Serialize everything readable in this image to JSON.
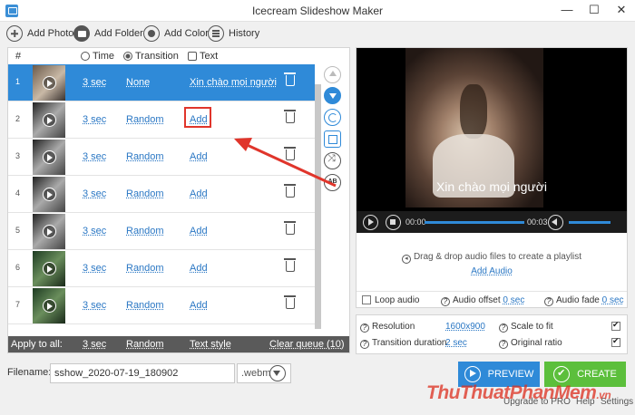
{
  "window": {
    "title": "Icecream Slideshow Maker",
    "minimize": "—",
    "maximize": "☐",
    "close": "✕"
  },
  "toolbar": {
    "add_photo": "Add Photo",
    "add_folder": "Add Folder",
    "add_color": "Add Color",
    "history": "History"
  },
  "columns": {
    "num": "#",
    "time": "Time",
    "transition": "Transition",
    "text": "Text"
  },
  "slides": [
    {
      "num": "1",
      "time": "3 sec",
      "transition": "None",
      "text": "Xin chào mọi người",
      "selected": true
    },
    {
      "num": "2",
      "time": "3 sec",
      "transition": "Random",
      "text": "Add"
    },
    {
      "num": "3",
      "time": "3 sec",
      "transition": "Random",
      "text": "Add"
    },
    {
      "num": "4",
      "time": "3 sec",
      "transition": "Random",
      "text": "Add"
    },
    {
      "num": "5",
      "time": "3 sec",
      "transition": "Random",
      "text": "Add"
    },
    {
      "num": "6",
      "time": "3 sec",
      "transition": "Random",
      "text": "Add"
    },
    {
      "num": "7",
      "time": "3 sec",
      "transition": "Random",
      "text": "Add"
    }
  ],
  "apply_all": {
    "label": "Apply to all:",
    "time": "3 sec",
    "transition": "Random",
    "text_style": "Text style",
    "clear": "Clear queue (10)"
  },
  "preview": {
    "caption": "Xin chào mọi người",
    "time_current": "00:00",
    "time_total": "00:03",
    "progress": 0.0
  },
  "audio": {
    "hint": "Drag & drop audio files to create a playlist",
    "add_audio": "Add Audio",
    "loop": "Loop audio",
    "offset_label": "Audio offset",
    "offset_value": "0 sec",
    "fade_label": "Audio fade",
    "fade_value": "0 sec"
  },
  "settings": {
    "resolution_label": "Resolution",
    "resolution_value": "1600x900",
    "transition_label": "Transition duration",
    "transition_value": "2 sec",
    "scale_label": "Scale to fit",
    "ratio_label": "Original ratio"
  },
  "file": {
    "label": "Filename:",
    "value": "sshow_2020-07-19_180902",
    "ext": ".webm"
  },
  "actions": {
    "preview": "PREVIEW",
    "create": "CREATE"
  },
  "footer": {
    "upgrade": "Upgrade to PRO",
    "help": "Help",
    "settings": "Settings"
  },
  "watermark": {
    "main": "ThuThuatPhanMem",
    "sub": ".vn"
  },
  "colors": {
    "accent": "#2f8ad8",
    "create": "#5cbf3c",
    "highlight": "#e0352b"
  }
}
